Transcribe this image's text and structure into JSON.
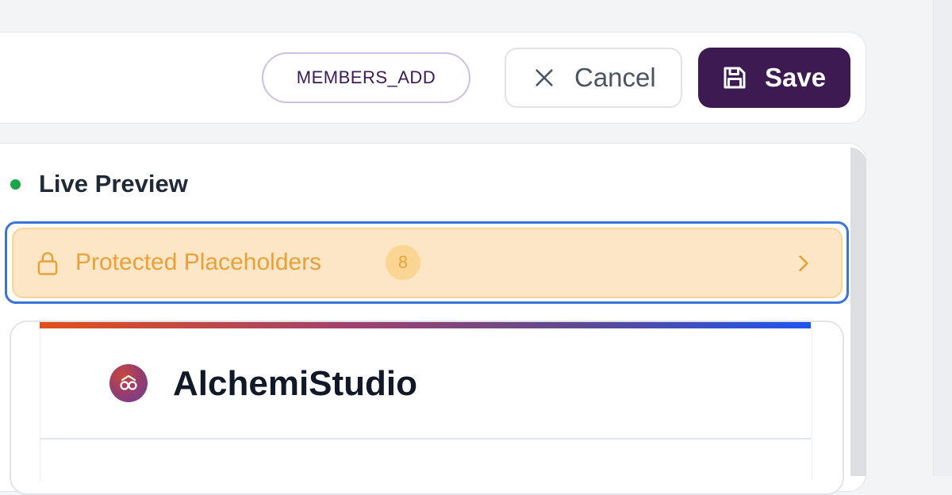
{
  "toolbar": {
    "permission_badge": "MEMBERS_ADD",
    "cancel_label": "Cancel",
    "save_label": "Save",
    "save_color": "#3d1a52"
  },
  "preview": {
    "status_label": "Live Preview",
    "status_color": "#1aa548"
  },
  "protected": {
    "title": "Protected Placeholders",
    "count": "8",
    "accent": "#e6a13a",
    "background": "#fde6c5"
  },
  "email": {
    "brand_name": "AlchemiStudio",
    "logo_icon": "infinity-bridge-logo"
  },
  "icons": {
    "cancel": "close-icon",
    "save": "floppy-disk-icon",
    "lock": "lock-icon",
    "chevron": "chevron-right-icon"
  }
}
